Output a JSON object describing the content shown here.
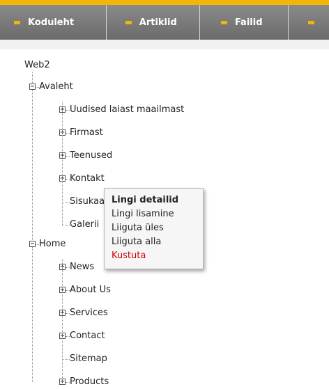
{
  "nav": {
    "items": [
      {
        "label": "Koduleht"
      },
      {
        "label": "Artiklid"
      },
      {
        "label": "Failid"
      },
      {
        "label": ""
      }
    ]
  },
  "tree": {
    "root": "Web2",
    "groups": [
      {
        "label": "Avaleht",
        "children": [
          {
            "label": "Uudised laiast maailmast",
            "expandable": true
          },
          {
            "label": "Firmast",
            "expandable": true
          },
          {
            "label": "Teenused",
            "expandable": true
          },
          {
            "label": "Kontakt",
            "expandable": true
          },
          {
            "label": "Sisukaart",
            "expandable": false
          },
          {
            "label": "Galerii",
            "expandable": false
          }
        ]
      },
      {
        "label": "Home",
        "children": [
          {
            "label": "News",
            "expandable": true
          },
          {
            "label": "About Us",
            "expandable": true
          },
          {
            "label": "Services",
            "expandable": true
          },
          {
            "label": "Contact",
            "expandable": true
          },
          {
            "label": "Sitemap",
            "expandable": false
          },
          {
            "label": "Products",
            "expandable": true
          }
        ]
      }
    ]
  },
  "context_menu": {
    "items": [
      {
        "label": "Lingi detailid",
        "style": "bold"
      },
      {
        "label": "Lingi lisamine",
        "style": "normal"
      },
      {
        "label": "Liiguta üles",
        "style": "normal"
      },
      {
        "label": "Liiguta alla",
        "style": "normal"
      },
      {
        "label": "Kustuta",
        "style": "danger"
      }
    ]
  },
  "icons": {
    "nav_bullet": "yellow-bullet-icon",
    "expand": "plus-box-icon",
    "collapse": "minus-box-icon"
  },
  "colors": {
    "accent": "#f2b705",
    "navbar": "#7b7b7b",
    "danger": "#cc0000"
  }
}
